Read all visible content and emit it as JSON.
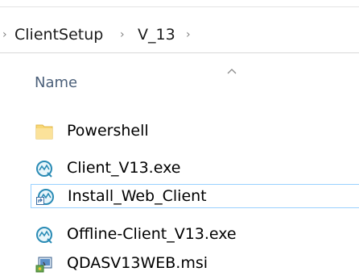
{
  "breadcrumb": {
    "items": [
      "ClientSetup",
      "V_13"
    ]
  },
  "column_header": {
    "name_label": "Name",
    "sort_direction": "ascending"
  },
  "files": [
    {
      "name": "Powershell",
      "icon": "folder-icon",
      "selected": false
    },
    {
      "name": "Client_V13.exe",
      "icon": "installer-exe-icon",
      "selected": false
    },
    {
      "name": "Install_Web_Client",
      "icon": "shortcut-icon",
      "selected": true
    },
    {
      "name": "Offline-Client_V13.exe",
      "icon": "installer-exe-icon",
      "selected": false
    },
    {
      "name": "QDASV13WEB.msi",
      "icon": "msi-package-icon",
      "selected": false
    }
  ],
  "colors": {
    "selection_border": "#99d1ff",
    "column_header_text": "#4c607a",
    "folder_yellow": "#f8d775",
    "exe_icon_teal": "#2a8bb5"
  }
}
